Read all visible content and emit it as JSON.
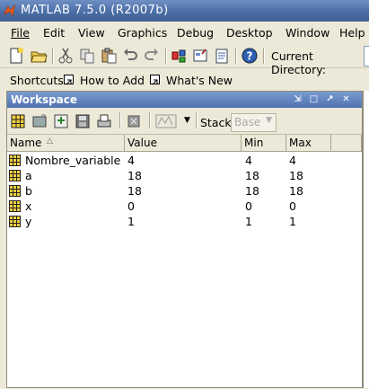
{
  "window": {
    "title": "MATLAB  7.5.0 (R2007b)"
  },
  "menu": [
    {
      "label": "File"
    },
    {
      "label": "Edit"
    },
    {
      "label": "View"
    },
    {
      "label": "Graphics"
    },
    {
      "label": "Debug"
    },
    {
      "label": "Desktop"
    },
    {
      "label": "Window"
    },
    {
      "label": "Help"
    }
  ],
  "toolbar": {
    "current_directory_label": "Current Directory:"
  },
  "shortcuts": {
    "label": "Shortcuts",
    "how_to_add": "How to Add",
    "whats_new": "What's New"
  },
  "workspace": {
    "title": "Workspace",
    "stack_label": "Stack:",
    "stack_value": "Base",
    "columns": [
      "Name",
      "Value",
      "Min",
      "Max"
    ],
    "rows": [
      {
        "name": "Nombre_variable",
        "value": "4",
        "min": "4",
        "max": "4"
      },
      {
        "name": "a",
        "value": "18",
        "min": "18",
        "max": "18"
      },
      {
        "name": "b",
        "value": "18",
        "min": "18",
        "max": "18"
      },
      {
        "name": "x",
        "value": "0",
        "min": "0",
        "max": "0"
      },
      {
        "name": "y",
        "value": "1",
        "min": "1",
        "max": "1"
      }
    ]
  },
  "icons": {
    "toolbar": [
      "new-file-icon",
      "open-folder-icon",
      "cut-icon",
      "copy-icon",
      "paste-icon",
      "undo-icon",
      "redo-icon",
      "simulink-icon",
      "guide-icon",
      "profiler-icon",
      "help-icon"
    ],
    "workspace_tools": [
      "new-variable-icon",
      "open-selection-icon",
      "import-data-icon",
      "save-icon",
      "print-icon",
      "delete-icon",
      "plot-icon"
    ]
  },
  "colors": {
    "title_bar": "#4b6ea6",
    "panel_title": "#5b7fbf",
    "background": "#ece9d8"
  }
}
